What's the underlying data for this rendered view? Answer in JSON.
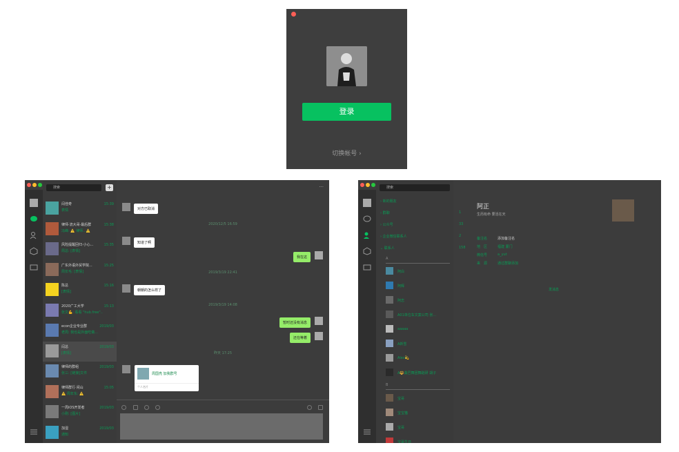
{
  "login": {
    "button_label": "登录",
    "switch_label": "切换帐号 ›"
  },
  "chat": {
    "search_placeholder": "搜索",
    "plus_label": "+",
    "more_label": "···",
    "conversations": [
      {
        "name": "闫佳奇",
        "snippet": "表情",
        "time": "15:39",
        "count": "",
        "color": "#4aa3a0"
      },
      {
        "name": "律师·流大哥·最后群",
        "snippet": "冯峰: ⚠️ 律师...⚠️",
        "time": "15:38",
        "count": "",
        "color": "#b05a3c"
      },
      {
        "name": "风险提醒回归·小心...",
        "snippet": "周总: [表情]",
        "time": "15:35",
        "count": "",
        "color": "#6a6a8a"
      },
      {
        "name": "广东外语外贸学院...",
        "snippet": "周长毛: [表情]",
        "time": "15:25",
        "count": "",
        "color": "#8a6a5a"
      },
      {
        "name": "陈总",
        "snippet": "[表情]",
        "time": "15:16",
        "count": "",
        "color": "#f4d21f"
      },
      {
        "name": "2020广工大学",
        "snippet": "张文💪: 看看 \"hub.free\"...",
        "time": "15:13",
        "count": "",
        "color": "#7a7ab0"
      },
      {
        "name": "econ企业专业群",
        "snippet": "老周: 我也是外面吃做...",
        "time": "2019/03",
        "count": "",
        "color": "#5a7ab0"
      },
      {
        "name": "闫总",
        "snippet": "[表情]",
        "time": "2019/03",
        "count": "",
        "color": "#9a9a9a"
      },
      {
        "name": "律师的群组",
        "snippet": "张三: [链接]文件",
        "time": "2019/03",
        "count": "",
        "color": "#6a8ab0"
      },
      {
        "name": "律师群行·闲山",
        "snippet": "⚠️ 周年东: ⚠️",
        "time": "15:05",
        "count": "",
        "color": "#b0705a"
      },
      {
        "name": "一周iOS开发者",
        "snippet": "小刚: [图片]",
        "time": "2019/03",
        "count": "",
        "color": "#7a7a7a"
      },
      {
        "name": "加湿",
        "snippet": "通知",
        "time": "2019/03",
        "count": "",
        "color": "#3aa0c0"
      }
    ],
    "messages": {
      "m1": "对方已取消",
      "ts1": "2020/12/5 16:59",
      "m2": "知道了啊",
      "m3": "我在这",
      "ts2": "2019/3/19 22:41",
      "m4": "朝朝的怎么样了",
      "ts3": "2019/3/19 14:08",
      "m5": "暂时还没有消息",
      "m6": "还在等着",
      "ts4": "昨天 17:25",
      "card_title": "周国亮 加我群号",
      "card_footer": "个人名片"
    }
  },
  "contacts": {
    "search_placeholder": "搜索",
    "groups": [
      {
        "label": "› 新的朋友",
        "count": ""
      },
      {
        "label": "› 群聊",
        "count": "1"
      },
      {
        "label": "› 公众号",
        "count": "33"
      },
      {
        "label": "› 企业微信联系人",
        "count": "2"
      },
      {
        "label": "⌄ 联系人",
        "count": "158"
      }
    ],
    "letter_a": "A",
    "letter_b": "B",
    "list": [
      {
        "name": "阿白",
        "color": "#4a8aa0"
      },
      {
        "name": "阿辉",
        "color": "#2f7ab0"
      },
      {
        "name": "阿志",
        "color": "#6a6a6a"
      },
      {
        "name": "A01单位车文案公司 张...",
        "color": "#5a5a5a"
      },
      {
        "name": "aaaaa",
        "color": "#bbbbbb"
      },
      {
        "name": "A新雪",
        "color": "#8aa0c0"
      },
      {
        "name": "Alex💫",
        "color": "#9a9a9a"
      },
      {
        "name": "A🔱桑巴舞团舞蹈研 胡子",
        "color": "#2a2a2a"
      },
      {
        "name": "宝哥",
        "color": "#6a5a4a"
      },
      {
        "name": "宝宝猫",
        "color": "#a08a7a"
      },
      {
        "name": "宝哥",
        "color": "#aaaaaa"
      },
      {
        "name": "宝哥生日",
        "color": "#c03a3a"
      }
    ],
    "detail": {
      "name": "阿正",
      "signature": "生而有命 要活在天",
      "rows": [
        {
          "label": "备注名",
          "value": "添加备注名"
        },
        {
          "label": "地　区",
          "value": "福建 厦门"
        },
        {
          "label": "微信号",
          "value": "a_yut"
        },
        {
          "label": "来　源",
          "value": "通过群聊添加"
        }
      ],
      "send_label": "发消息"
    }
  }
}
